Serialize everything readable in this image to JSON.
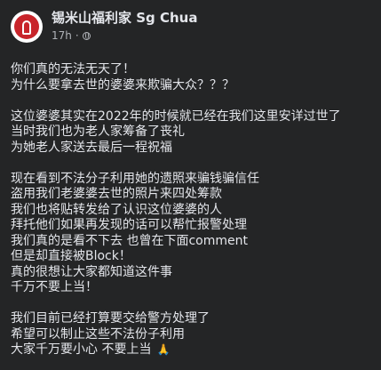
{
  "post": {
    "page_name": "锡米山福利家 Sg Chua",
    "time": "17h",
    "separator": "·",
    "privacy_icon": "globe-icon",
    "paragraphs": [
      {
        "lines": [
          "你们真的无法无天了！",
          "为什么要拿去世的婆婆来欺骗大众？？？"
        ]
      },
      {
        "lines": [
          "这位婆婆其实在2022年的时候就已经在我们这里安详过世了",
          "当时我们也为老人家筹备了丧礼",
          "为她老人家送去最后一程祝福"
        ]
      },
      {
        "lines": [
          "现在看到不法分子利用她的遗照来骗钱骗信任",
          "盗用我们老婆婆去世的照片来四处筹款",
          "我们也将贴转发给了认识这位婆婆的人",
          "拜托他们如果再发现的话可以帮忙报警处理",
          "我们真的是看不下去 也曾在下面comment",
          "但是却直接被Block！",
          "真的很想让大家都知道这件事",
          "千万不要上当！"
        ]
      },
      {
        "lines": [
          "我们目前已经打算要交给警方处理了",
          "希望可以制止这些不法份子利用",
          "大家千万要小心 不要上当"
        ],
        "emoji": "🙏"
      }
    ]
  }
}
